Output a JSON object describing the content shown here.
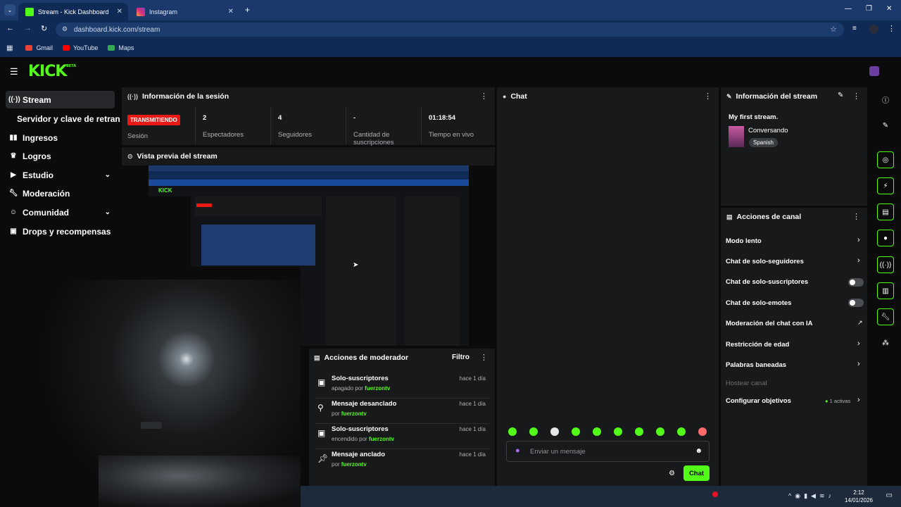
{
  "browser": {
    "tabs": [
      {
        "title": "Stream - Kick Dashboard",
        "active": true
      },
      {
        "title": "Instagram",
        "active": false
      }
    ],
    "url": "dashboard.kick.com/stream",
    "bookmarks": [
      "Gmail",
      "YouTube",
      "Maps"
    ]
  },
  "brand": {
    "logo": "KICK",
    "badge": "BETA",
    "accent": "#53fc18"
  },
  "sidebar": {
    "items": [
      {
        "icon": "broadcast-icon",
        "label": "Stream",
        "active": true
      },
      {
        "icon": "",
        "label": "Servidor y clave de retransm"
      },
      {
        "icon": "bar-chart-icon",
        "label": "Ingresos"
      },
      {
        "icon": "trophy-icon",
        "label": "Logros"
      },
      {
        "icon": "video-icon",
        "label": "Estudio",
        "expandable": true
      },
      {
        "icon": "wrench-icon",
        "label": "Moderación"
      },
      {
        "icon": "community-icon",
        "label": "Comunidad",
        "expandable": true
      },
      {
        "icon": "gift-icon",
        "label": "Drops y recompensas"
      }
    ]
  },
  "session": {
    "title": "Información de la sesión",
    "status": "TRANSMITIENDO",
    "status_label": "Sesión",
    "stats": [
      {
        "value": "2",
        "label": "Espectadores"
      },
      {
        "value": "4",
        "label": "Seguidores"
      },
      {
        "value": "-",
        "label": "Cantidad de suscripciones"
      },
      {
        "value": "01:18:54",
        "label": "Tiempo en vivo"
      }
    ]
  },
  "preview": {
    "title": "Vista previa del stream"
  },
  "chat": {
    "title": "Chat",
    "placeholder": "Enviar un mensaje",
    "send": "Chat"
  },
  "stream_info": {
    "title": "Información del stream",
    "stream_title": "My first stream.",
    "category": "Conversando",
    "language": "Spanish"
  },
  "channel_actions": {
    "title": "Acciones de canal",
    "items": [
      {
        "label": "Modo lento",
        "control": "chevron"
      },
      {
        "label": "Chat de solo-seguidores",
        "control": "chevron"
      },
      {
        "label": "Chat de solo-suscriptores",
        "control": "toggle",
        "on": false
      },
      {
        "label": "Chat de solo-emotes",
        "control": "toggle",
        "on": false
      },
      {
        "label": "Moderación del chat con IA",
        "control": "external"
      },
      {
        "label": "Restricción de edad",
        "control": "chevron"
      },
      {
        "label": "Palabras baneadas",
        "control": "chevron"
      },
      {
        "label": "Hostear canal",
        "control": "none",
        "disabled": true
      },
      {
        "label": "Configurar objetivos",
        "control": "chevron",
        "extra": "1 activas"
      }
    ]
  },
  "mod_actions": {
    "title": "Acciones de moderador",
    "filter": "Filtro",
    "items": [
      {
        "icon": "gift-icon",
        "title": "Solo-suscriptores",
        "prefix": "apagado por",
        "user": "fuerzontv",
        "time": "hace 1 día"
      },
      {
        "icon": "unpin-icon",
        "title": "Mensaje desanclado",
        "prefix": "por",
        "user": "fuerzontv",
        "time": "hace 1 día"
      },
      {
        "icon": "gift-icon",
        "title": "Solo-suscriptores",
        "prefix": "encendido por",
        "user": "fuerzontv",
        "time": "hace 1 día"
      },
      {
        "icon": "pin-icon",
        "title": "Mensaje anclado",
        "prefix": "por",
        "user": "fuerzontv",
        "time": "hace 1 día"
      }
    ]
  },
  "taskbar": {
    "time": "2:12",
    "date": "14/01/2026"
  }
}
